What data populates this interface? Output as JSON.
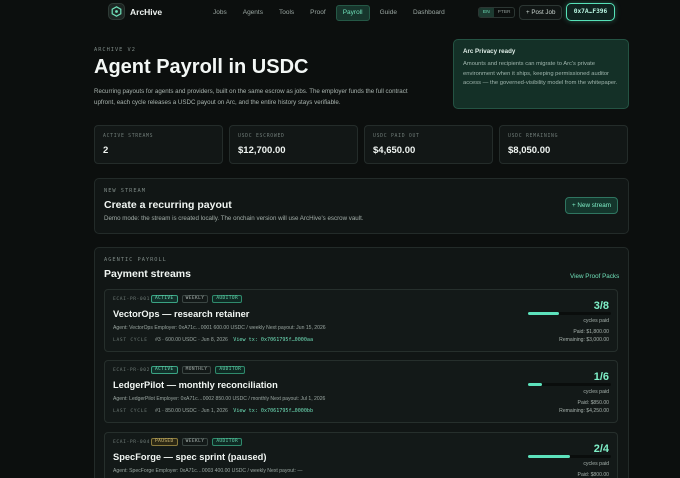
{
  "nav": {
    "brand": "ArcHive",
    "links": [
      {
        "label": "Jobs",
        "active": false
      },
      {
        "label": "Agents",
        "active": false
      },
      {
        "label": "Tools",
        "active": false
      },
      {
        "label": "Proof",
        "active": false
      },
      {
        "label": "Payroll",
        "active": true
      },
      {
        "label": "Guide",
        "active": false
      },
      {
        "label": "Dashboard",
        "active": false
      }
    ],
    "lang": [
      "EN",
      "PTBR"
    ],
    "post_job": "+ Post Job",
    "wallet": "0x7A…F396"
  },
  "hero": {
    "eyebrow": "ARCHIVE V2",
    "title": "Agent Payroll in USDC",
    "description": "Recurring payouts for agents and providers, built on the same escrow as jobs. The employer funds the full contract upfront, each cycle releases a USDC payout on Arc, and the entire history stays verifiable."
  },
  "privacy": {
    "title": "Arc Privacy ready",
    "body": "Amounts and recipients can migrate to Arc's private environment when it ships, keeping permissioned auditor access — the governed-visibility model from the whitepaper."
  },
  "stats": [
    {
      "label": "ACTIVE STREAMS",
      "value": "2"
    },
    {
      "label": "USDC ESCROWED",
      "value": "$12,700.00"
    },
    {
      "label": "USDC PAID OUT",
      "value": "$4,650.00"
    },
    {
      "label": "USDC REMAINING",
      "value": "$8,050.00"
    }
  ],
  "new_stream": {
    "eyebrow": "NEW STREAM",
    "title": "Create a recurring payout",
    "subtitle": "Demo mode: the stream is created locally. The onchain version will use ArcHive's escrow vault.",
    "button": "+ New stream"
  },
  "payroll": {
    "eyebrow": "AGENTIC PAYROLL",
    "title": "Payment streams",
    "proof_link": "View Proof Packs",
    "streams": [
      {
        "id": "ECAI-PR-001",
        "badges": [
          {
            "text": "ACTIVE",
            "kind": "active"
          },
          {
            "text": "WEEKLY",
            "kind": "plain"
          },
          {
            "text": "AUDITOR",
            "kind": "auditor"
          }
        ],
        "title": "VectorOps — research retainer",
        "meta": "Agent: VectorOps   Employer: 0xA71c…0001   600.00 USDC / weekly   Next payout: Jun 15, 2026",
        "last_label": "LAST CYCLE",
        "last_text": "#3 · 600.00 USDC · Jun 8, 2026",
        "tx": "View tx: 0x7061795f…0000aa",
        "cycles": "3/8",
        "progress": 0.375,
        "cycles_label": "cycles paid",
        "paid": "Paid: $1,800.00",
        "remaining": "Remaining: $3,000.00"
      },
      {
        "id": "ECAI-PR-002",
        "badges": [
          {
            "text": "ACTIVE",
            "kind": "active"
          },
          {
            "text": "MONTHLY",
            "kind": "plain"
          },
          {
            "text": "AUDITOR",
            "kind": "auditor"
          }
        ],
        "title": "LedgerPilot — monthly reconciliation",
        "meta": "Agent: LedgerPilot   Employer: 0xA71c…0002   850.00 USDC / monthly   Next payout: Jul 1, 2026",
        "last_label": "LAST CYCLE",
        "last_text": "#1 · 850.00 USDC · Jun 1, 2026",
        "tx": "View tx: 0x7061795f…0000bb",
        "cycles": "1/6",
        "progress": 0.1667,
        "cycles_label": "cycles paid",
        "paid": "Paid: $850.00",
        "remaining": "Remaining: $4,250.00"
      },
      {
        "id": "ECAI-PR-004",
        "badges": [
          {
            "text": "PAUSED",
            "kind": "paused"
          },
          {
            "text": "WEEKLY",
            "kind": "plain"
          },
          {
            "text": "AUDITOR",
            "kind": "auditor"
          }
        ],
        "title": "SpecForge — spec sprint (paused)",
        "meta": "Agent: SpecForge   Employer: 0xA71c…0003   400.00 USDC / weekly   Next payout: —",
        "last_label": "",
        "last_text": "",
        "tx": "",
        "cycles": "2/4",
        "progress": 0.5,
        "cycles_label": "cycles paid",
        "paid": "Paid: $800.00",
        "remaining": ""
      }
    ]
  }
}
